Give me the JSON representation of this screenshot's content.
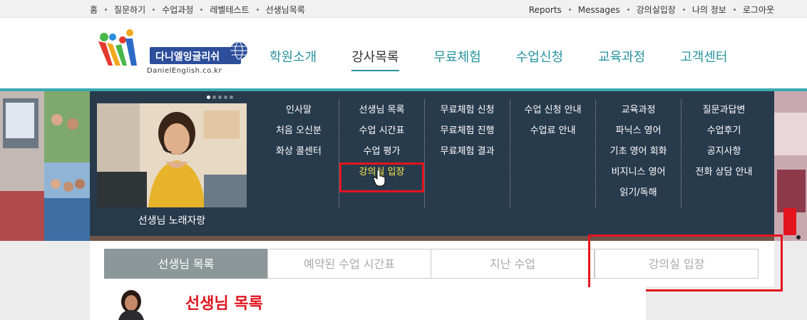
{
  "topbar": {
    "left": [
      "홈",
      "질문하기",
      "수업과정",
      "레벨테스트",
      "선생님목록"
    ],
    "right": [
      "Reports",
      "Messages",
      "강의실입장",
      "나의 정보",
      "로그아웃"
    ]
  },
  "logo": {
    "name": "다니엘잉글리쉬",
    "url_text": "DanielEnglish.co.kr"
  },
  "gnb": [
    "학원소개",
    "강사목록",
    "무료체험",
    "수업신청",
    "교육과정",
    "고객센터"
  ],
  "gnb_active_index": 1,
  "mega": {
    "teacher_caption": "선생님 노래자랑",
    "columns": [
      [
        "인사말",
        "처음 오신분",
        "화상 콜센터"
      ],
      [
        "선생님 목록",
        "수업 시간표",
        "수업 평가",
        "강의실 입장"
      ],
      [
        "무료체험 신청",
        "무료체험 진행",
        "무료체험 결과"
      ],
      [
        "수업 신청 안내",
        "수업료 안내"
      ],
      [
        "교육과정",
        "파닉스 영어",
        "기초 영어 회화",
        "비지니스 영어",
        "읽기/독해"
      ],
      [
        "질문과답변",
        "수업후기",
        "공지사항",
        "전화 상담 안내"
      ]
    ],
    "highlighted": "강의실 입장"
  },
  "tabs": [
    "선생님 목록",
    "예약된 수업 시간표",
    "지난 수업",
    "강의실 입장"
  ],
  "tab_active_index": 0,
  "list_title": "선생님 목록",
  "colors": {
    "teal": "#27939e",
    "nav_bg": "#283b4d",
    "red": "#e4141f",
    "highlight": "#ffe84a",
    "tab_active": "#8c9799"
  }
}
